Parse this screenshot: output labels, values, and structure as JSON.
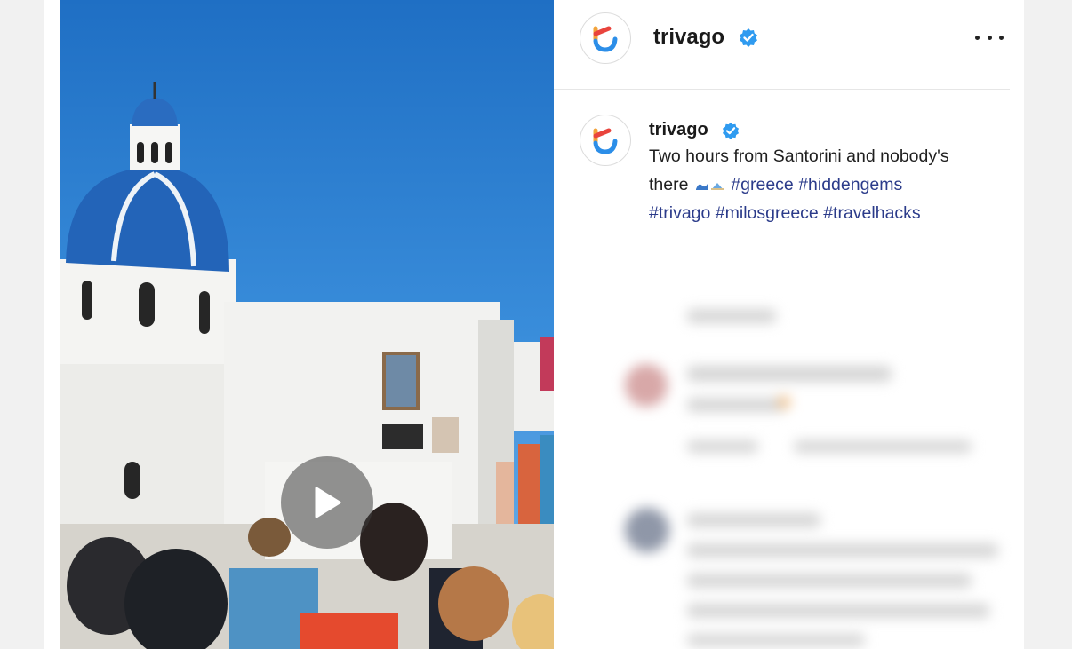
{
  "post": {
    "author": "trivago",
    "verified": true,
    "more_icon": "more-horizontal-icon",
    "caption": {
      "author": "trivago",
      "text_line1": "Two hours from Santorini and nobody's",
      "text_line2_prefix": "there",
      "emoji": "🌊🏖️",
      "hashtags": [
        "#greece",
        "#hiddengems",
        "#trivago",
        "#milosgreece",
        "#travelhacks"
      ]
    },
    "media": {
      "type": "video",
      "play_icon": "play-icon"
    }
  },
  "colors": {
    "brand_orange": "#f2a33a",
    "brand_red": "#e9443d",
    "brand_blue": "#2c8ee8",
    "verified_blue": "#2f9bf0",
    "hashtag": "#2b3b8a"
  }
}
